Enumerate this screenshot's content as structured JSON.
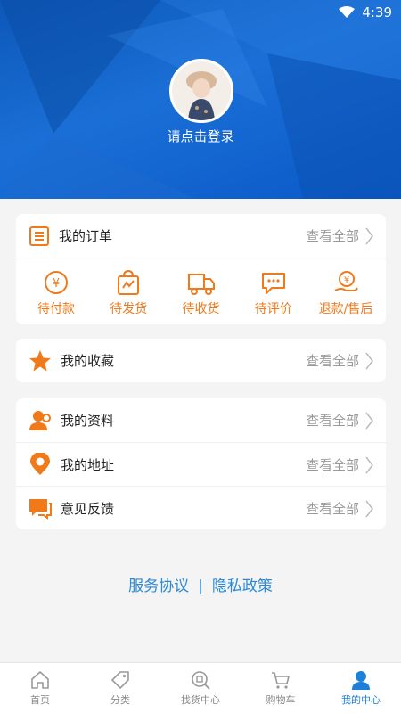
{
  "status_bar": {
    "time": "4:39"
  },
  "profile": {
    "login_prompt": "请点击登录"
  },
  "orders": {
    "title": "我的订单",
    "view_all": "查看全部",
    "items": [
      {
        "label": "待付款",
        "icon": "pending-payment-icon"
      },
      {
        "label": "待发货",
        "icon": "pending-shipment-icon"
      },
      {
        "label": "待收货",
        "icon": "truck-icon"
      },
      {
        "label": "待评价",
        "icon": "comment-icon"
      },
      {
        "label": "退款/售后",
        "icon": "refund-icon"
      }
    ]
  },
  "favorites": {
    "title": "我的收藏",
    "view_all": "查看全部"
  },
  "account": {
    "rows": [
      {
        "title": "我的资料",
        "view_all": "查看全部",
        "icon": "profile-icon"
      },
      {
        "title": "我的地址",
        "view_all": "查看全部",
        "icon": "location-icon"
      },
      {
        "title": "意见反馈",
        "view_all": "查看全部",
        "icon": "feedback-icon"
      }
    ]
  },
  "links": {
    "terms": "服务协议",
    "separator": "|",
    "privacy": "隐私政策"
  },
  "tabbar": {
    "tabs": [
      {
        "label": "首页"
      },
      {
        "label": "分类"
      },
      {
        "label": "找货中心"
      },
      {
        "label": "购物车"
      },
      {
        "label": "我的中心"
      }
    ]
  },
  "colors": {
    "accent_orange": "#f07a1a",
    "primary_blue": "#1e7fd8",
    "header_blue": "#0d5ec4"
  }
}
